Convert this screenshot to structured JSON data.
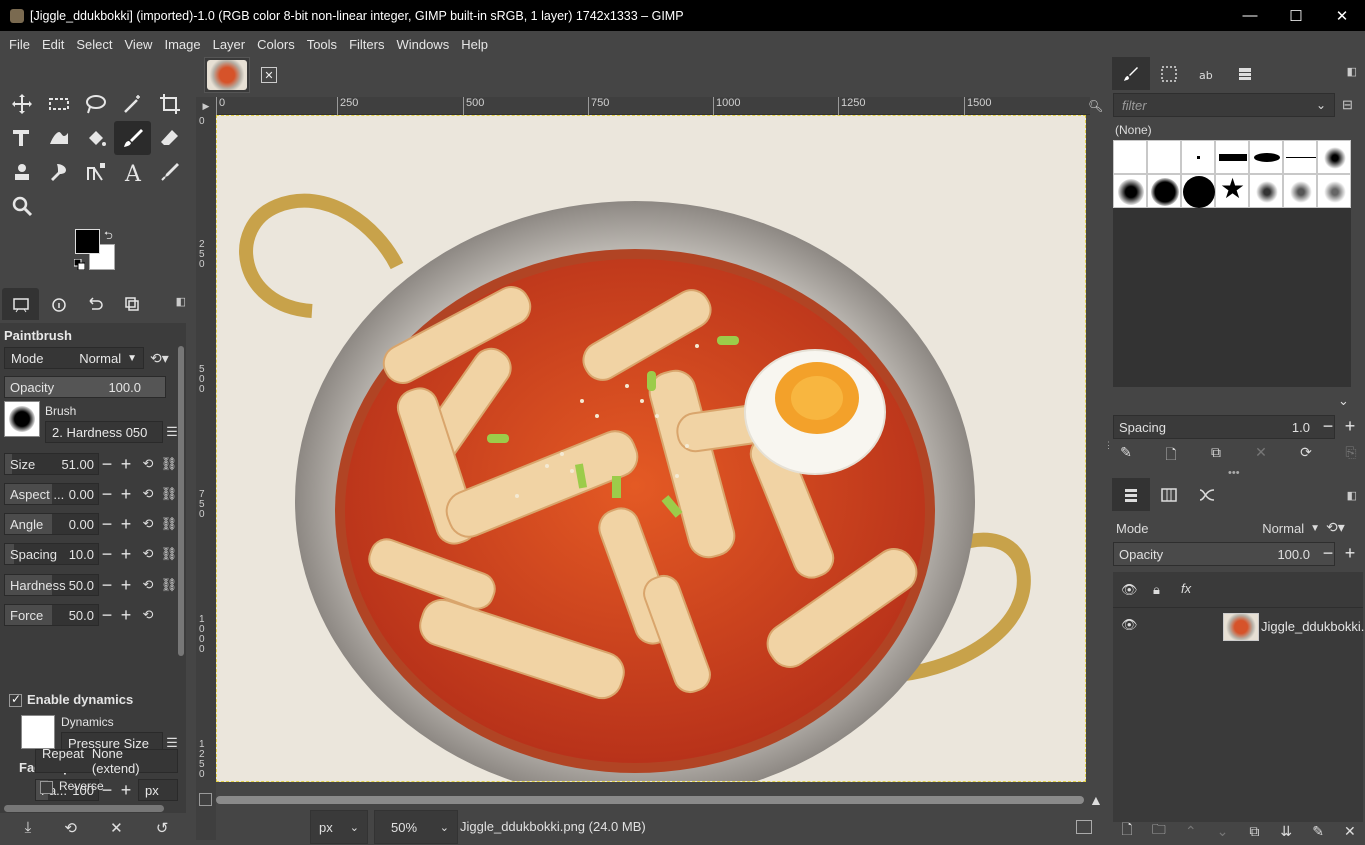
{
  "window": {
    "title": "[Jiggle_ddukbokki] (imported)-1.0 (RGB color 8-bit non-linear integer, GIMP built-in sRGB, 1 layer) 1742x1333 – GIMP",
    "minimize": "—",
    "maximize": "☐",
    "close": "✕"
  },
  "menubar": [
    "File",
    "Edit",
    "Select",
    "View",
    "Image",
    "Layer",
    "Colors",
    "Tools",
    "Filters",
    "Windows",
    "Help"
  ],
  "toolbox": {
    "tools": [
      "move-tool",
      "rect-select-tool",
      "free-select-tool",
      "fuzzy-select-tool",
      "crop-tool",
      "unified-transform-tool",
      "warp-transform-tool",
      "bucket-fill-tool",
      "paintbrush-tool",
      "eraser-tool",
      "clone-tool",
      "smudge-tool",
      "paths-tool",
      "text-tool",
      "color-picker-tool",
      "zoom-tool"
    ],
    "active_tool": "paintbrush-tool",
    "fg_color": "#000000",
    "bg_color": "#ffffff"
  },
  "tool_options": {
    "title": "Paintbrush",
    "mode_label": "Mode",
    "mode_value": "Normal",
    "opacity_label": "Opacity",
    "opacity_value": "100.0",
    "brush_label": "Brush",
    "brush_value": "2. Hardness 050",
    "size_label": "Size",
    "size_value": "51.00",
    "aspect_label": "Aspect ...",
    "aspect_value": "0.00",
    "angle_label": "Angle",
    "angle_value": "0.00",
    "spacing_label": "Spacing",
    "spacing_value": "10.0",
    "hardness_label": "Hardness",
    "hardness_value": "50.0",
    "force_label": "Force",
    "force_value": "50.0",
    "enable_dynamics": "Enable dynamics",
    "dynamics_label": "Dynamics",
    "dynamics_value": "Pressure Size",
    "fade_options": "Fade Options",
    "fade_label": "Fa...",
    "fade_value": "100",
    "fade_unit": "px",
    "repeat_label": "Repeat",
    "repeat_value": "None (extend)",
    "reverse_label": "Reverse"
  },
  "canvas": {
    "ruler_h": [
      "0",
      "250",
      "500",
      "750",
      "1000",
      "1250",
      "1500"
    ],
    "ruler_v": [
      "0",
      "250",
      "500",
      "750",
      "1000",
      "1250"
    ],
    "unit": "px",
    "zoom": "50%",
    "file_info": "Jiggle_ddukbokki.png (24.0 MB)"
  },
  "brushes": {
    "filter_placeholder": "filter",
    "selected": "(None)",
    "spacing_label": "Spacing",
    "spacing_value": "1.0"
  },
  "layers": {
    "mode_label": "Mode",
    "mode_value": "Normal",
    "opacity_label": "Opacity",
    "opacity_value": "100.0",
    "items": [
      {
        "name": "Jiggle_ddukbokki.p"
      }
    ]
  }
}
